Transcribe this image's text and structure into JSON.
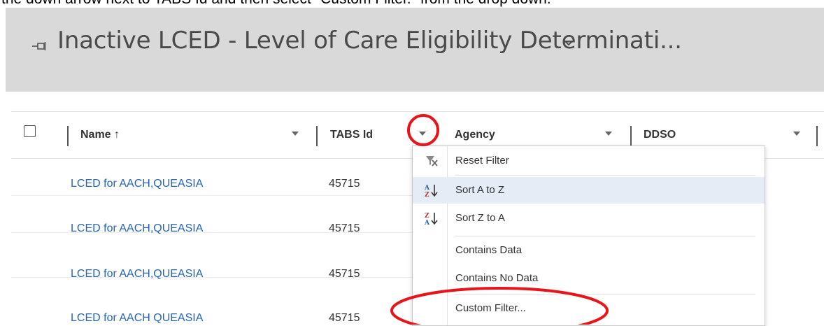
{
  "instruction": "the down arrow next to TABS Id and then select \"Custom Filter.\" from the drop down.",
  "view": {
    "title": "Inactive LCED - Level of Care Eligibility Determinati...",
    "pin_icon": "pin-icon",
    "chevron_icon": "chevron-down-icon"
  },
  "grid": {
    "columns": [
      {
        "label": "Name ↑",
        "sort": "ascending",
        "has_filter": true
      },
      {
        "label": "TABS Id",
        "has_filter": true,
        "highlighted": true
      },
      {
        "label": "Agency",
        "has_filter": true
      },
      {
        "label": "DDSO",
        "has_filter": true
      }
    ],
    "rows": [
      {
        "name": "LCED for AACH,QUEASIA",
        "tabs_id": "45715"
      },
      {
        "name": "LCED for AACH,QUEASIA",
        "tabs_id": "45715"
      },
      {
        "name": "LCED for AACH,QUEASIA",
        "tabs_id": "45715"
      },
      {
        "name": "LCED for AACH QUEASIA",
        "tabs_id": "45715"
      }
    ]
  },
  "filter_menu": {
    "items": [
      {
        "label": "Reset Filter",
        "icon": "reset-filter-icon"
      },
      {
        "label": "Sort A to Z",
        "icon": "sort-a-z-icon",
        "hovered": true
      },
      {
        "label": "Sort Z to A",
        "icon": "sort-z-a-icon"
      },
      {
        "label": "Contains Data",
        "icon": ""
      },
      {
        "label": "Contains No Data",
        "icon": ""
      },
      {
        "label": "Custom Filter...",
        "icon": "",
        "highlighted": true
      }
    ]
  },
  "colors": {
    "header_band": "#d9d9d9",
    "link": "#2366b8",
    "hover": "#e5ecf6",
    "annotation": "#e8141a"
  }
}
